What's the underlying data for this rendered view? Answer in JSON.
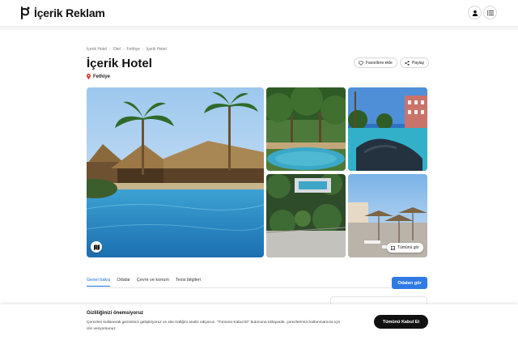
{
  "header": {
    "brand": "İçerik Reklam",
    "user_icon": "user-icon",
    "menu_icon": "list-icon"
  },
  "breadcrumb": [
    "İçerik Hotel",
    "Otel",
    "Fethiye",
    "İçerik Hotel"
  ],
  "hotel": {
    "name": "İçerik Hotel",
    "location": "Fethiye"
  },
  "actions": {
    "favorite_label": "Favorilere ekle",
    "share_label": "Paylaş"
  },
  "gallery": {
    "see_all_label": "Tümünü gör"
  },
  "tabs": [
    {
      "label": "Genel bakış",
      "active": true
    },
    {
      "label": "Odalar",
      "active": false
    },
    {
      "label": "Çevre ve konum",
      "active": false
    },
    {
      "label": "Tesis bilgileri",
      "active": false
    }
  ],
  "rooms_button": "Odaları gör",
  "cookie": {
    "title": "Gizliliğinizi önemsiyoruz",
    "text": "Çerezleri kullanarak gezintinizi geliştiriyoruz ve site trafiğini analiz ediyoruz. \"Tümünü Kabul Et\" butonuna tıklayarak, çerezlerimizi kullanmamıza için izin veriyorsunuz.",
    "accept_label": "Tümünü Kabul Et"
  },
  "colors": {
    "accent": "#2f7ae5",
    "location_pin": "#e53935"
  }
}
